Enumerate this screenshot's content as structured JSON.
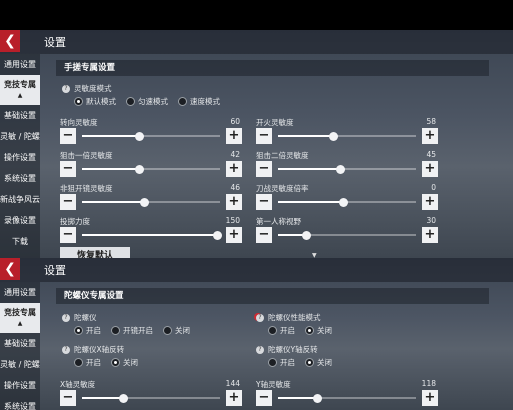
{
  "icons": {
    "back": "chevron-left-icon",
    "question": "question-icon"
  },
  "colors": {
    "accent": "#b81f2a",
    "active_tab_bg": "#e8eaed"
  },
  "panel1": {
    "header_title": "设置",
    "sidebar": [
      {
        "label": "通用设置",
        "active": false
      },
      {
        "label": "竞技专属",
        "active": true
      },
      {
        "label": "基础设置",
        "active": false
      },
      {
        "label": "灵敏 / 陀螺",
        "active": false
      },
      {
        "label": "操作设置",
        "active": false
      },
      {
        "label": "系统设置",
        "active": false
      },
      {
        "label": "新战争风云",
        "active": false
      },
      {
        "label": "录像设置",
        "active": false
      },
      {
        "label": "下载",
        "active": false
      }
    ],
    "section_title": "手搓专属设置",
    "sensitivity_mode": {
      "label": "灵敏度模式",
      "options": [
        "默认模式",
        "匀速模式",
        "速度模式"
      ],
      "selected": 0
    },
    "sliders": [
      {
        "label": "转向灵敏度",
        "value": 60,
        "level": 0.41
      },
      {
        "label": "开火灵敏度",
        "value": 58,
        "level": 0.4
      },
      {
        "label": "狙击一倍灵敏度",
        "value": 42,
        "level": 0.41
      },
      {
        "label": "狙击二倍灵敏度",
        "value": 45,
        "level": 0.45
      },
      {
        "label": "非狙开镜灵敏度",
        "value": 46,
        "level": 0.45
      },
      {
        "label": "刀战灵敏度倍率",
        "value": 0,
        "level": 0.47
      },
      {
        "label": "投掷力度",
        "value": 150,
        "level": 0.98
      },
      {
        "label": "第一人称视野",
        "value": 30,
        "level": 0.2
      }
    ],
    "reset_label": "恢复默认"
  },
  "panel2": {
    "header_title": "设置",
    "sidebar": [
      {
        "label": "通用设置",
        "active": false
      },
      {
        "label": "竞技专属",
        "active": true
      },
      {
        "label": "基础设置",
        "active": false
      },
      {
        "label": "灵敏 / 陀螺",
        "active": false
      },
      {
        "label": "操作设置",
        "active": false
      },
      {
        "label": "系统设置",
        "active": false
      }
    ],
    "section_title": "陀螺仪专属设置",
    "gyro": {
      "label": "陀螺仪",
      "options": [
        "开启",
        "开镜开启",
        "关闭"
      ],
      "selected": 0
    },
    "gyro_perf": {
      "label": "陀螺仪性能模式",
      "options": [
        "开启",
        "关闭"
      ],
      "selected": 1
    },
    "gyro_x": {
      "label": "陀螺仪X轴反转",
      "options": [
        "开启",
        "关闭"
      ],
      "selected": 1
    },
    "gyro_y": {
      "label": "陀螺仪Y轴反转",
      "options": [
        "开启",
        "关闭"
      ],
      "selected": 1
    },
    "sliders": [
      {
        "label": "X轴灵敏度",
        "value": 144,
        "level": 0.3
      },
      {
        "label": "Y轴灵敏度",
        "value": 118,
        "level": 0.28
      }
    ]
  }
}
